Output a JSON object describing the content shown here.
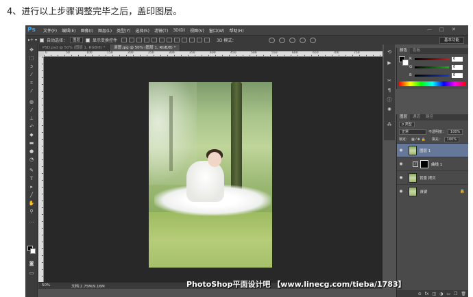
{
  "caption": "4、进行以上步骤调整完毕之后，盖印图层。",
  "app": {
    "logo": "Ps",
    "menu": [
      "文件(F)",
      "编辑(E)",
      "图像(I)",
      "图层(L)",
      "类型(Y)",
      "选择(S)",
      "滤镜(T)",
      "3D(D)",
      "视图(V)",
      "窗口(W)",
      "帮助(H)"
    ],
    "window_controls": [
      "—",
      "□",
      "✕"
    ]
  },
  "options": {
    "auto_select_label": "自动选择：",
    "auto_select_value": "图层",
    "show_transform_label": "显示变换控件",
    "mode_3d_label": "3D 模式：",
    "workspace": "基本功能"
  },
  "tabs": [
    {
      "label": "PSD.psd @ 50% (图层 1, RGB/8) *"
    },
    {
      "label": "原图.jpg @ 50% (图层 1, RGB/8) *"
    }
  ],
  "ruler_numbers": [
    "0",
    "50",
    "100",
    "150",
    "200",
    "250",
    "300",
    "350",
    "400",
    "450",
    "500",
    "550",
    "600",
    "650",
    "700",
    "750"
  ],
  "status": {
    "zoom": "50%",
    "doc": "文档:2.75M/9.16M"
  },
  "watermark": "PhotoShop平面设计吧 【www.linecg.com/tieba/1783】",
  "color_panel": {
    "tabs": [
      "颜色",
      "色板"
    ],
    "channels": [
      {
        "label": "R",
        "value": "0",
        "color": "#d01818"
      },
      {
        "label": "G",
        "value": "0",
        "color": "#18b018"
      },
      {
        "label": "B",
        "value": "0",
        "color": "#1838d0"
      }
    ]
  },
  "layers_panel": {
    "tabs": [
      "图层",
      "通道",
      "路径"
    ],
    "kind_filter": "ρ 类型",
    "blend_mode": "正常",
    "opacity_label": "不透明度：",
    "opacity_value": "100%",
    "lock_label": "锁定：",
    "fill_label": "填充：",
    "fill_value": "100%",
    "layers": [
      {
        "name": "图层 1",
        "selected": true,
        "kind": "pixel"
      },
      {
        "name": "曲线 1",
        "selected": false,
        "kind": "adjustment"
      },
      {
        "name": "背景 拷贝",
        "selected": false,
        "kind": "pixel"
      },
      {
        "name": "背景",
        "selected": false,
        "kind": "background"
      }
    ]
  }
}
